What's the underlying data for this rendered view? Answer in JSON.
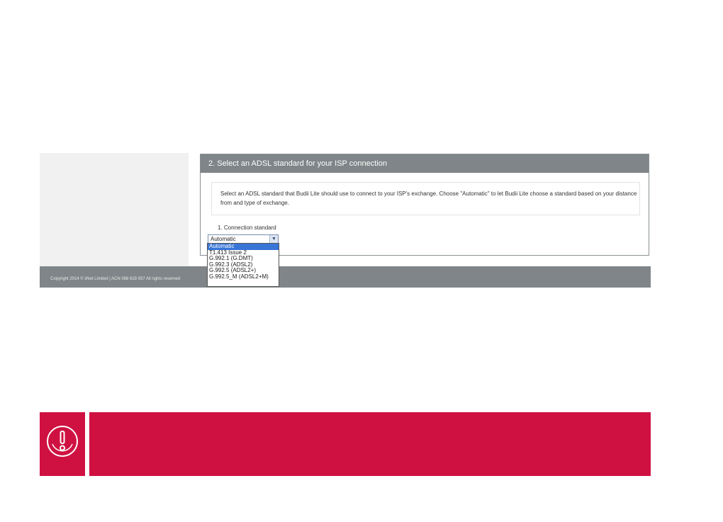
{
  "section": {
    "title": "2. Select an ADSL standard for your ISP connection",
    "description": "Select an ADSL standard that Budii Lite should use to connect to your ISP's exchange. Choose \"Automatic\" to let Budii Lite choose a standard based on your distance from and type of exchange.",
    "field_label": "1.  Connection standard",
    "selected_value": "Automatic",
    "options": [
      "Automatic",
      "T1.413 Issue 2",
      "G.992.1 (G.DMT)",
      "G.992.3 (ADSL2)",
      "G.992.5 (ADSL2+)",
      "G.992.5_M (ADSL2+M)"
    ]
  },
  "footer": {
    "copyright": "Copyright 2014 © iiNet Limited | ACN 068 628 937 All rights reserved"
  },
  "icons": {
    "select_arrow": "chevron-down-icon",
    "alert": "exclamation-icon"
  },
  "colors": {
    "header_bg": "#7f8588",
    "alert_bg": "#cf1142",
    "selected_option": "#3875d7"
  }
}
